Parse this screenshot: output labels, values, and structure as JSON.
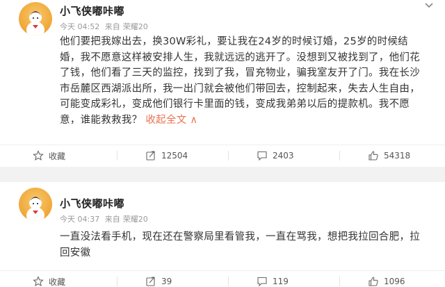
{
  "posts": [
    {
      "username": "小飞侠嘟咔嘟",
      "time": "今天 04:52",
      "source_prefix": "来自",
      "device": "荣耀20",
      "text": "他们要把我嫁出去，换30W彩礼，要让我在24岁的时候订婚，25岁的时候结婚，我不愿意这样被安排人生，我就远远的逃开了。没想到又被找到了，他们花了钱，他们看了三天的监控，找到了我，冒充物业，骗我室友开了门。我在长沙市岳麓区西湖派出所，我一出门就会被他们带回去，控制起来，失去人生自由，可能变成彩礼，变成他们银行卡里面的钱，变成我弟弟以后的提款机。我不愿意，谁能救救我？",
      "collapse_label": "收起全文 ∧",
      "actions": {
        "favorite": "收藏",
        "repost": "12504",
        "comment": "2403",
        "like": "54318"
      }
    },
    {
      "username": "小飞侠嘟咔嘟",
      "time": "今天 04:37",
      "source_prefix": "来自",
      "device": "荣耀20",
      "text": "一直没法看手机，现在还在警察局里看管我，一直在骂我，想把我拉回合肥，拉回安徽",
      "actions": {
        "favorite": "收藏",
        "repost": "39",
        "comment": "119",
        "like": "1096"
      }
    }
  ],
  "colors": {
    "accent": "#eb7350",
    "meta": "#999999",
    "background": "#f2f2f2",
    "avatar": "#f0a637"
  },
  "icons": {
    "more": "chevron-down-icon",
    "favorite": "star-icon",
    "repost": "repost-icon",
    "comment": "comment-icon",
    "like": "thumbs-up-icon"
  }
}
